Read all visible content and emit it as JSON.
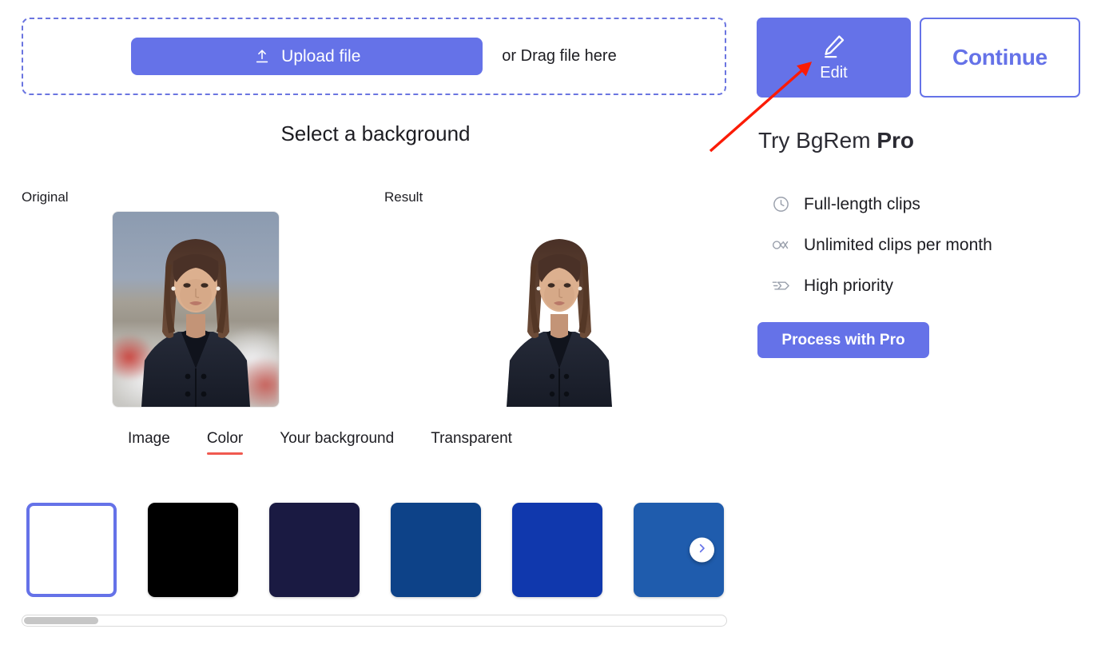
{
  "uploader": {
    "upload_label": "Upload file",
    "upload_icon": "upload-arrow-icon",
    "drag_text": "or Drag file here",
    "border_color": "#6b75e0",
    "button_color": "#6572e8"
  },
  "section": {
    "title": "Select a background"
  },
  "previews": {
    "original_label": "Original",
    "result_label": "Result"
  },
  "tabs": [
    {
      "label": "Image",
      "active": false
    },
    {
      "label": "Color",
      "active": true
    },
    {
      "label": "Your background",
      "active": false
    },
    {
      "label": "Transparent",
      "active": false
    }
  ],
  "tab_underline_color": "#f05a50",
  "swatches": [
    {
      "name": "white",
      "color": "#ffffff",
      "selected": true
    },
    {
      "name": "black",
      "color": "#000000",
      "selected": false
    },
    {
      "name": "dark-navy",
      "color": "#1a1a42",
      "selected": false
    },
    {
      "name": "deep-blue",
      "color": "#0d4288",
      "selected": false
    },
    {
      "name": "royal-blue",
      "color": "#1038ad",
      "selected": false
    },
    {
      "name": "medium-blue",
      "color": "#1f5cad",
      "selected": false
    }
  ],
  "swatch_next_icon": "chevron-right-icon",
  "scrollbar": {
    "name": "horizontal-scrollbar",
    "thumb_position": "left"
  },
  "actions": {
    "edit_label": "Edit",
    "edit_icon": "pencil-edit-icon",
    "continue_label": "Continue"
  },
  "pro": {
    "title_prefix": "Try BgRem ",
    "title_strong": "Pro",
    "features": [
      {
        "icon": "clock-icon",
        "label": "Full-length clips"
      },
      {
        "icon": "infinity-icon",
        "label": "Unlimited clips per month"
      },
      {
        "icon": "fast-forward-arrow-icon",
        "label": "High priority"
      }
    ],
    "cta_label": "Process with Pro",
    "accent_color": "#6572e8"
  },
  "annotation": {
    "type": "arrow",
    "color": "#fb1b05",
    "points_to": "edit-button"
  }
}
